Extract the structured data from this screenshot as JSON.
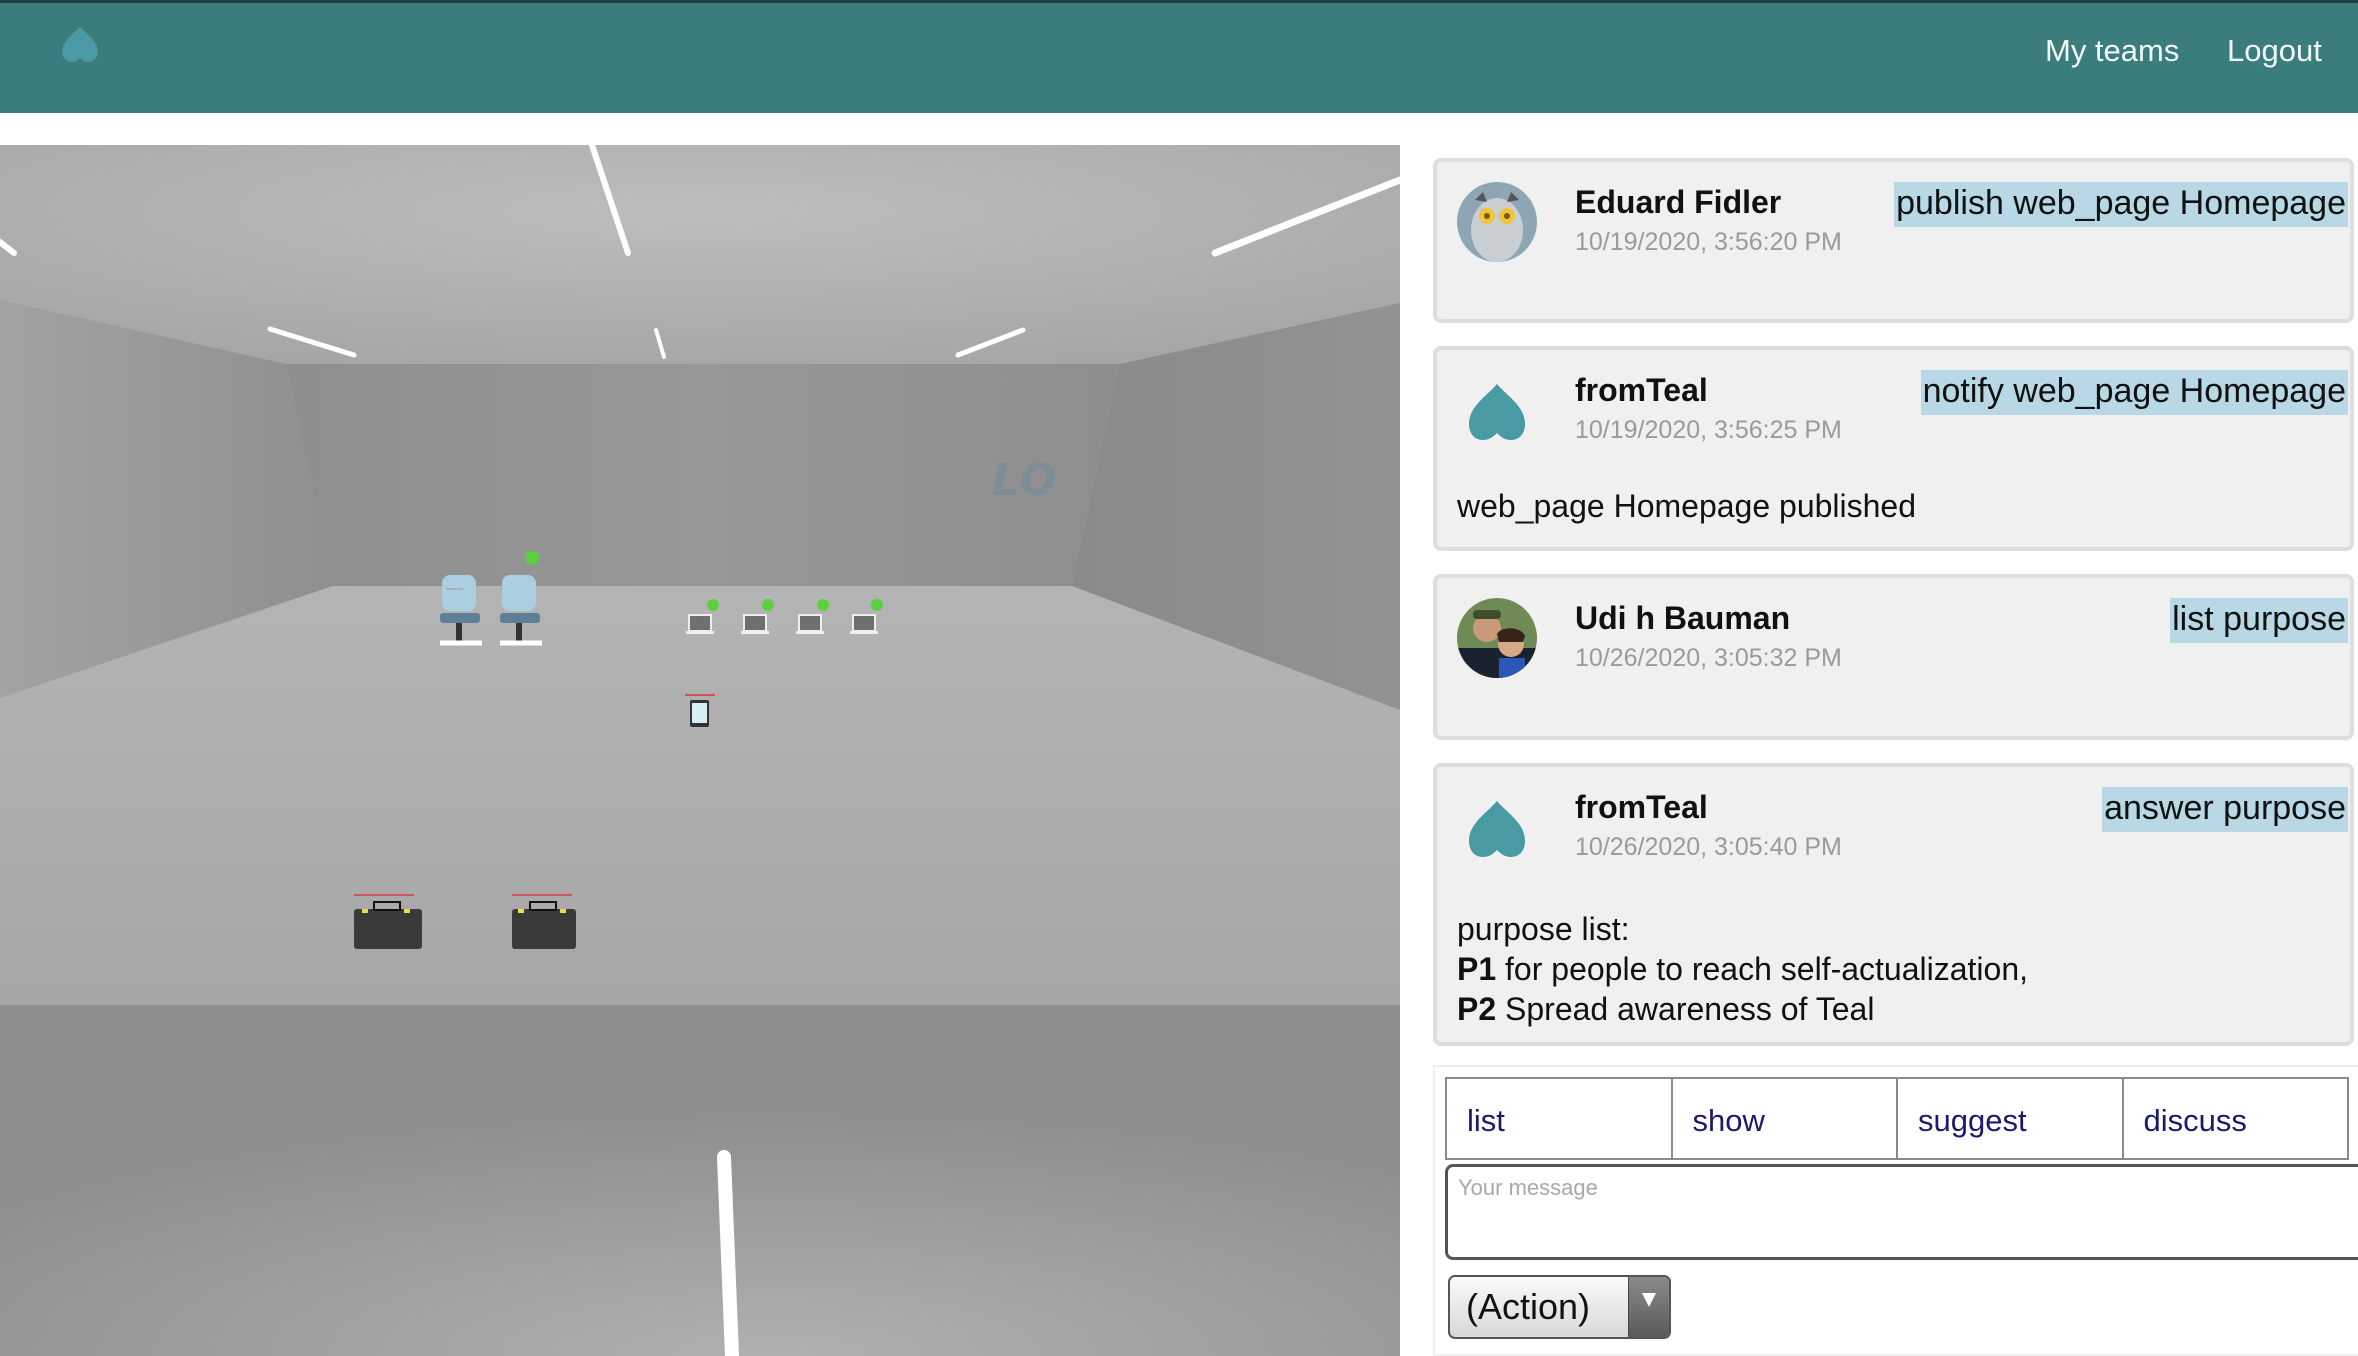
{
  "header": {
    "logo_icon": "teal-heart-icon",
    "nav": [
      {
        "label": "My teams"
      },
      {
        "label": "Logout"
      }
    ]
  },
  "scene": {
    "wall_label": "LO",
    "objects": [
      {
        "type": "office-chair",
        "checked": false
      },
      {
        "type": "office-chair",
        "checked": true
      },
      {
        "type": "laptop",
        "checked": true
      },
      {
        "type": "laptop",
        "checked": true
      },
      {
        "type": "laptop",
        "checked": true
      },
      {
        "type": "laptop",
        "checked": true
      },
      {
        "type": "tablet",
        "checked": false
      },
      {
        "type": "briefcase",
        "checked": false
      },
      {
        "type": "briefcase",
        "checked": false
      }
    ]
  },
  "feed": {
    "messages": [
      {
        "author": "Eduard Fidler",
        "time": "10/19/2020, 3:56:20 PM",
        "action": "publish web_page Homepage",
        "avatar": "user-photo"
      },
      {
        "author": "fromTeal",
        "time": "10/19/2020, 3:56:25 PM",
        "action": "notify web_page Homepage",
        "avatar": "teal-heart-icon",
        "body": "web_page Homepage published"
      },
      {
        "author": "Udi h Bauman",
        "time": "10/26/2020, 3:05:32 PM",
        "action": "list purpose",
        "avatar": "user-photo"
      },
      {
        "author": "fromTeal",
        "time": "10/26/2020, 3:05:40 PM",
        "action": "answer purpose",
        "avatar": "teal-heart-icon",
        "body_intro": "purpose list:",
        "body_items": [
          {
            "id": "P1",
            "text": " for people to reach self-actualization,"
          },
          {
            "id": "P2",
            "text": " Spread awareness of Teal"
          }
        ]
      }
    ]
  },
  "composer": {
    "tabs": [
      "list",
      "show",
      "suggest",
      "discuss"
    ],
    "message_placeholder": "Your message",
    "message_value": "",
    "action_select": "(Action)"
  },
  "colors": {
    "header_bg": "#3a7d7c",
    "teal_accent": "#4a9aa3",
    "action_highlight": "#b7d8e4",
    "tab_text": "#1a1a6e",
    "check_green": "#5ccf3e"
  }
}
